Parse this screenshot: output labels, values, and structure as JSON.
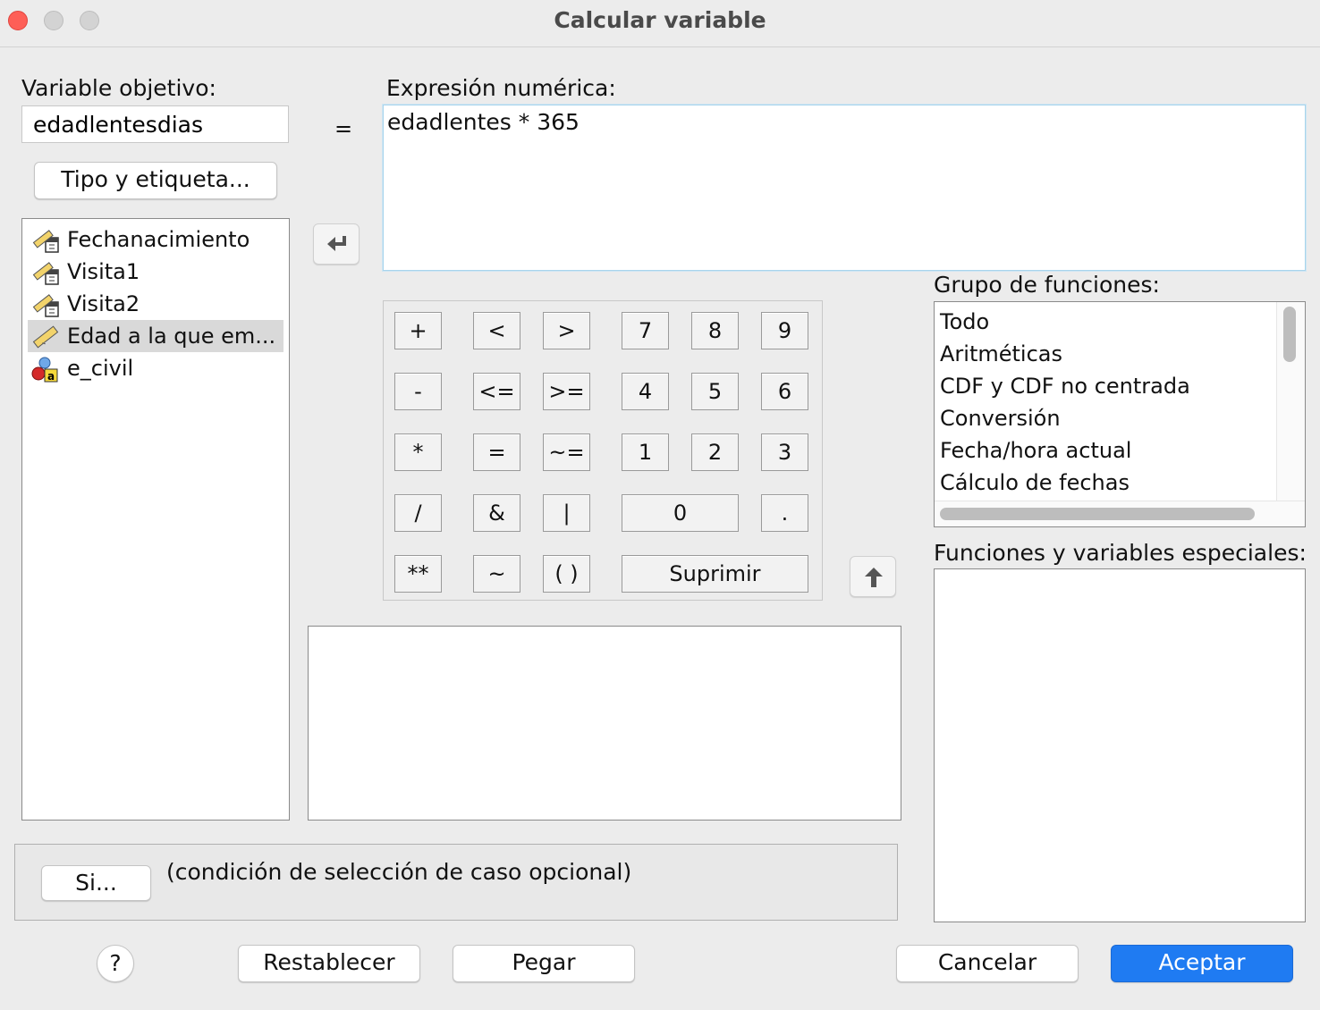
{
  "window": {
    "title": "Calcular variable"
  },
  "target": {
    "label": "Variable objetivo:",
    "value": "edadlentesdias",
    "type_label_button": "Tipo y etiqueta..."
  },
  "equals_sign": "=",
  "expression": {
    "label": "Expresión numérica:",
    "value": "edadlentes * 365"
  },
  "variables": [
    {
      "name": "Fechanacimiento",
      "icon": "scale-date-icon"
    },
    {
      "name": "Visita1",
      "icon": "scale-date-icon"
    },
    {
      "name": "Visita2",
      "icon": "scale-date-icon"
    },
    {
      "name": "Edad a la que em...",
      "icon": "ruler-scale-icon",
      "selected": true
    },
    {
      "name": "e_civil",
      "icon": "nominal-string-icon"
    }
  ],
  "keypad": {
    "plus": "+",
    "lt": "<",
    "gt": ">",
    "k7": "7",
    "k8": "8",
    "k9": "9",
    "minus": "-",
    "le": "<=",
    "ge": ">=",
    "k4": "4",
    "k5": "5",
    "k6": "6",
    "mult": "*",
    "eq": "=",
    "ne": "~=",
    "k1": "1",
    "k2": "2",
    "k3": "3",
    "div": "/",
    "and": "&",
    "or": "|",
    "k0": "0",
    "dot": ".",
    "pow": "**",
    "not": "~",
    "paren": "( )",
    "delete": "Suprimir"
  },
  "function_group": {
    "label": "Grupo de funciones:",
    "items": [
      "Todo",
      "Aritméticas",
      "CDF y CDF no centrada",
      "Conversión",
      "Fecha/hora actual",
      "Cálculo de fechas"
    ]
  },
  "special_functions": {
    "label": "Funciones y variables especiales:"
  },
  "condition": {
    "if_button": "Si...",
    "text": "(condición de selección de caso opcional)"
  },
  "footer": {
    "help": "?",
    "reset": "Restablecer",
    "paste": "Pegar",
    "cancel": "Cancelar",
    "ok": "Aceptar"
  },
  "colors": {
    "accent": "#1f7bf2",
    "selected_row": "#d9d9d9",
    "field_focus": "#a8d4ec"
  }
}
